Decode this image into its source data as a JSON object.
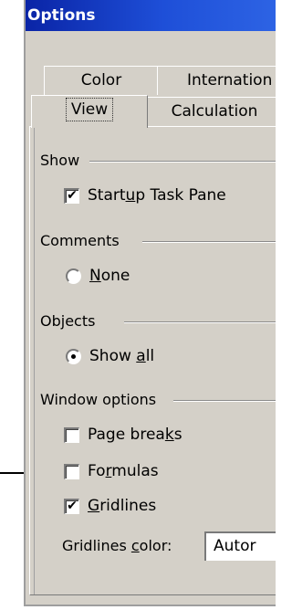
{
  "dialog": {
    "title": "Options"
  },
  "tabs": {
    "color": "Color",
    "international": "Internation",
    "view": "View",
    "calculation": "Calculation"
  },
  "show_group": {
    "label": "Show",
    "startup_task_pane": {
      "pre": "Start",
      "accel": "u",
      "post": "p Task Pane",
      "checked": true
    }
  },
  "comments_group": {
    "label": "Comments",
    "none": {
      "pre": "",
      "accel": "N",
      "post": "one",
      "selected": false
    }
  },
  "objects_group": {
    "label": "Objects",
    "show_all": {
      "pre": "Show ",
      "accel": "a",
      "post": "ll",
      "selected": true
    }
  },
  "window_group": {
    "label": "Window options",
    "page_breaks": {
      "pre": "Page brea",
      "accel": "k",
      "post": "s",
      "checked": false
    },
    "formulas": {
      "pre": "Fo",
      "accel": "r",
      "post": "mulas",
      "checked": false
    },
    "gridlines": {
      "pre": "",
      "accel": "G",
      "post": "ridlines",
      "checked": true
    },
    "gridlines_color": {
      "pre": "Gridlines ",
      "accel": "c",
      "post": "olor:",
      "value": "Autor"
    }
  },
  "check_glyph": "✔",
  "colors": {
    "title_start": "#0a24a6",
    "title_end": "#2d63e4",
    "face": "#d4d0c8"
  },
  "annotation": {
    "icon": "arrow-right-icon"
  }
}
